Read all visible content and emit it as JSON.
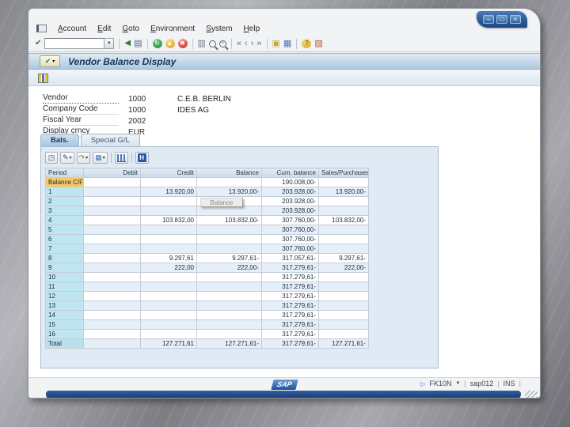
{
  "window_controls": {
    "minimize": "–",
    "maximize": "□",
    "close": "×"
  },
  "menu": {
    "items": [
      "Account",
      "Edit",
      "Goto",
      "Environment",
      "System",
      "Help"
    ]
  },
  "toolbar": {
    "command_value": "",
    "dropdown_glyph": "▼"
  },
  "title_bar": {
    "title": "Vendor Balance Display"
  },
  "header_fields": [
    {
      "label": "Vendor",
      "value": "1000",
      "description": "C.E.B. BERLIN"
    },
    {
      "label": "Company Code",
      "value": "1000",
      "description": "IDES AG"
    },
    {
      "label": "Fiscal Year",
      "value": "2002",
      "description": ""
    },
    {
      "label": "Display crncy",
      "value": "EUR",
      "description": ""
    }
  ],
  "tabs": [
    {
      "label": "Bals.",
      "active": true
    },
    {
      "label": "Special G/L",
      "active": false
    }
  ],
  "tooltip": {
    "text": "Balance"
  },
  "balance_table": {
    "columns": [
      "Period",
      "Debit",
      "Credit",
      "Balance",
      "Cum. balance",
      "Sales/Purchases"
    ],
    "rows": [
      {
        "period": "Balance C/F",
        "debit": "",
        "credit": "",
        "balance": "",
        "cum_balance": "190.008,00-",
        "sales_purchases": ""
      },
      {
        "period": "1",
        "debit": "",
        "credit": "13.920,00",
        "balance": "13.920,00-",
        "cum_balance": "203.928,00-",
        "sales_purchases": "13.920,00-"
      },
      {
        "period": "2",
        "debit": "",
        "credit": "",
        "balance": "",
        "cum_balance": "203.928,00-",
        "sales_purchases": ""
      },
      {
        "period": "3",
        "debit": "",
        "credit": "",
        "balance": "",
        "cum_balance": "203.928,00-",
        "sales_purchases": ""
      },
      {
        "period": "4",
        "debit": "",
        "credit": "103.832,00",
        "balance": "103.832,00-",
        "cum_balance": "307.760,00-",
        "sales_purchases": "103.832,00-"
      },
      {
        "period": "5",
        "debit": "",
        "credit": "",
        "balance": "",
        "cum_balance": "307.760,00-",
        "sales_purchases": ""
      },
      {
        "period": "6",
        "debit": "",
        "credit": "",
        "balance": "",
        "cum_balance": "307.760,00-",
        "sales_purchases": ""
      },
      {
        "period": "7",
        "debit": "",
        "credit": "",
        "balance": "",
        "cum_balance": "307.760,00-",
        "sales_purchases": ""
      },
      {
        "period": "8",
        "debit": "",
        "credit": "9.297,61",
        "balance": "9.297,61-",
        "cum_balance": "317.057,61-",
        "sales_purchases": "9.297,61-"
      },
      {
        "period": "9",
        "debit": "",
        "credit": "222,00",
        "balance": "222,00-",
        "cum_balance": "317.279,61-",
        "sales_purchases": "222,00-"
      },
      {
        "period": "10",
        "debit": "",
        "credit": "",
        "balance": "",
        "cum_balance": "317.279,61-",
        "sales_purchases": ""
      },
      {
        "period": "11",
        "debit": "",
        "credit": "",
        "balance": "",
        "cum_balance": "317.279,61-",
        "sales_purchases": ""
      },
      {
        "period": "12",
        "debit": "",
        "credit": "",
        "balance": "",
        "cum_balance": "317.279,61-",
        "sales_purchases": ""
      },
      {
        "period": "13",
        "debit": "",
        "credit": "",
        "balance": "",
        "cum_balance": "317.279,61-",
        "sales_purchases": ""
      },
      {
        "period": "14",
        "debit": "",
        "credit": "",
        "balance": "",
        "cum_balance": "317.279,61-",
        "sales_purchases": ""
      },
      {
        "period": "15",
        "debit": "",
        "credit": "",
        "balance": "",
        "cum_balance": "317.279,61-",
        "sales_purchases": ""
      },
      {
        "period": "16",
        "debit": "",
        "credit": "",
        "balance": "",
        "cum_balance": "317.279,61-",
        "sales_purchases": ""
      },
      {
        "period": "Total",
        "debit": "",
        "credit": "127.271,61",
        "balance": "127.271,61-",
        "cum_balance": "317.279,61-",
        "sales_purchases": "127.271,61-"
      }
    ]
  },
  "status_bar": {
    "transaction": "FK10N",
    "system": "sap012",
    "mode": "INS",
    "logo": "SAP"
  }
}
